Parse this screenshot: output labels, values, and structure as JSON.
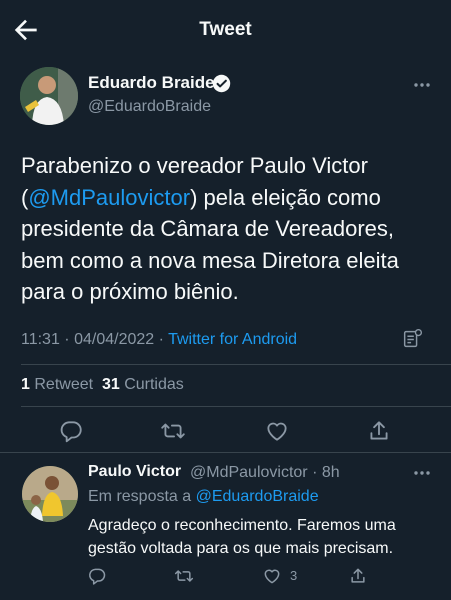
{
  "header": {
    "title": "Tweet"
  },
  "tweet": {
    "author_name": "Eduardo Braide",
    "author_handle": "@EduardoBraide",
    "text_before": "Parabenizo o vereador Paulo Victor (",
    "mention": "@MdPaulovictor",
    "text_after": ") pela eleição como presidente da Câmara de Vereadores, bem como a nova mesa Diretora eleita para o próximo biênio.",
    "time": "11:31",
    "date": "04/04/2022",
    "source": "Twitter for Android",
    "retweets_count": "1",
    "retweets_label": "Retweet",
    "likes_count": "31",
    "likes_label": "Curtidas"
  },
  "reply": {
    "author_name": "Paulo Victor",
    "author_handle": "@MdPaulovictor",
    "age": "8h",
    "in_reply_prefix": "Em resposta a",
    "in_reply_mention": "@EduardoBraide",
    "text": "Agradeço o reconhecimento. Faremos uma gestão voltada para os que mais precisam.",
    "likes_count": "3"
  },
  "colors": {
    "background": "#15202b",
    "accent": "#1d9bf0",
    "secondary_text": "#8b98a5",
    "divider": "#38444d"
  }
}
